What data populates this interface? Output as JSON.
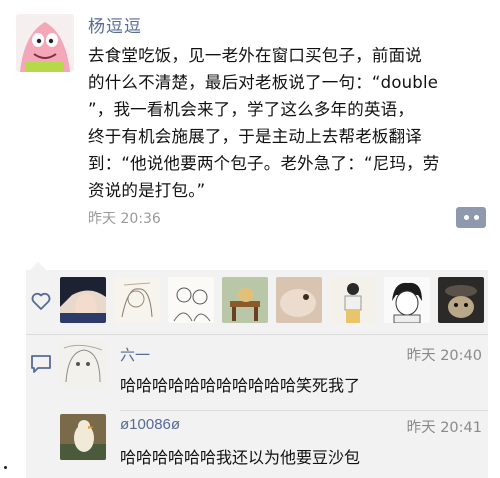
{
  "post": {
    "author": "杨逗逗",
    "text": "去食堂吃饭，见一老外在窗口买包子，前面说\n的什么不清楚，最后对老板说了一句：“double\n”，我一看机会来了，学了这么多年的英语，\n终于有机会施展了，于是主动上去帮老板翻译\n到：“他说他要两个包子。老外急了：“尼玛，劳\n资说的是打包。”",
    "time": "昨天 20:36",
    "avatar_icon": "cartoon-star-avatar",
    "more_icon": "two-dots-icon"
  },
  "likes": {
    "icon": "heart-outline-icon",
    "avatars": [
      "anime-portrait",
      "sketch-character",
      "sketch-figures",
      "cat-on-chair",
      "animal-closeup",
      "illustrated-person",
      "anime-boy",
      "cat-in-hat"
    ]
  },
  "comments": [
    {
      "name": "六一",
      "time": "昨天 20:40",
      "text": "哈哈哈哈哈哈哈哈哈哈哈笑死我了",
      "avatar": "sketch-girl"
    },
    {
      "name": "ø10086ø",
      "time": "昨天 20:41",
      "text": "哈哈哈哈哈哈我还以为他要豆沙包",
      "avatar": "duck-figure"
    }
  ],
  "comment_icon": "comment-bubble-icon",
  "colors": {
    "name_blue": "#576b95",
    "panel_bg": "#f2f2f2",
    "time_gray": "#9a9a9a",
    "more_btn": "#8e99ad"
  }
}
